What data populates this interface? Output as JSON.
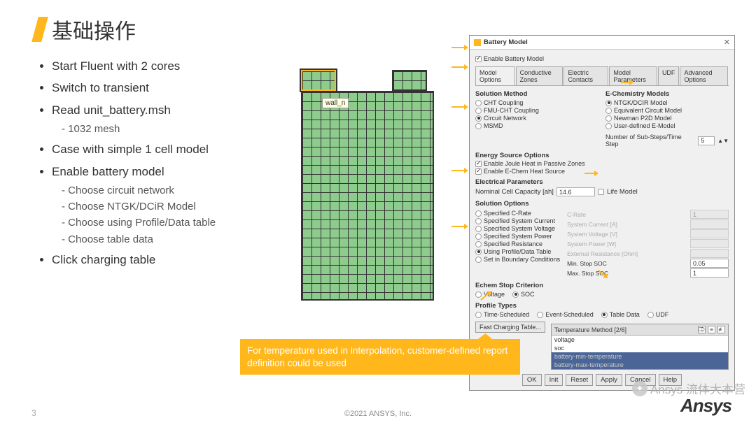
{
  "slide": {
    "title": "基础操作",
    "page_num": "3",
    "copyright": "©2021 ANSYS, Inc.",
    "ansys": "Ansys"
  },
  "bullets": [
    {
      "text": "Start Fluent with 2 cores"
    },
    {
      "text": "Switch to transient"
    },
    {
      "text": "Read unit_battery.msh",
      "sub": [
        "1032 mesh"
      ]
    },
    {
      "text": "Case with simple 1 cell model"
    },
    {
      "text": "Enable battery model",
      "sub": [
        "Choose circuit network",
        "Choose NTGK/DCiR Model",
        "Choose using Profile/Data table",
        "Choose table data"
      ]
    },
    {
      "text": "Click charging table"
    }
  ],
  "mesh": {
    "tooltip": "wall_n"
  },
  "callout": "For temperature used in interpolation, customer-defined report definition could be used",
  "dialog": {
    "title": "Battery Model",
    "enable": "Enable Battery Model",
    "tabs": [
      "Model Options",
      "Conductive Zones",
      "Electric Contacts",
      "Model Parameters",
      "UDF",
      "Advanced Options"
    ],
    "solution_method": {
      "title": "Solution Method",
      "opts": [
        "CHT Coupling",
        "FMU-CHT Coupling",
        "Circuit Network",
        "MSMD"
      ],
      "sel": 2
    },
    "echem_models": {
      "title": "E-Chemistry Models",
      "opts": [
        "NTGK/DCIR Model",
        "Equivalent Circuit Model",
        "Newman P2D Model",
        "User-defined E-Model"
      ],
      "sel": 0
    },
    "substeps": {
      "label": "Number of Sub-Steps/Time Step",
      "val": "5"
    },
    "energy": {
      "title": "Energy Source Options",
      "c1": "Enable Joule Heat in Passive Zones",
      "c2": "Enable E-Chem Heat Source"
    },
    "elec": {
      "title": "Electrical Parameters",
      "label": "Nominal Cell Capacity [ah]",
      "val": "14.6",
      "life": "Life Model"
    },
    "sol_opts": {
      "title": "Solution Options",
      "radios": [
        "Specified C-Rate",
        "Specified System Current",
        "Specified System Voltage",
        "Specified System Power",
        "Specified Resistance",
        "Using Profile/Data Table",
        "Set in Boundary Conditions"
      ],
      "sel": 5,
      "rlabels": [
        "C-Rate",
        "System Current [A]",
        "System Voltage [V]",
        "System Power [W]",
        "External Resistance [Ohm]"
      ],
      "rvals": [
        "1",
        "",
        "",
        "",
        ""
      ],
      "min_label": "Min. Stop SOC",
      "min_val": "0.05",
      "max_label": "Max. Stop SOC",
      "max_val": "1"
    },
    "echem_stop": {
      "title": "Echem Stop Criterion",
      "opts": [
        "Voltage",
        "SOC"
      ],
      "sel": 1
    },
    "profile": {
      "title": "Profile Types",
      "opts": [
        "Time-Scheduled",
        "Event-Scheduled",
        "Table Data",
        "UDF"
      ],
      "sel": 2,
      "fast_btn": "Fast Charging Table...",
      "temp_label": "Temperature Method [2/6]",
      "items": [
        "voltage",
        "soc",
        "battery-min-temperature",
        "battery-max-temperature"
      ],
      "sel_items": [
        2,
        3
      ]
    },
    "buttons": [
      "OK",
      "Init",
      "Reset",
      "Apply",
      "Cancel",
      "Help"
    ]
  },
  "watermark": "Ansys 流体大本营"
}
